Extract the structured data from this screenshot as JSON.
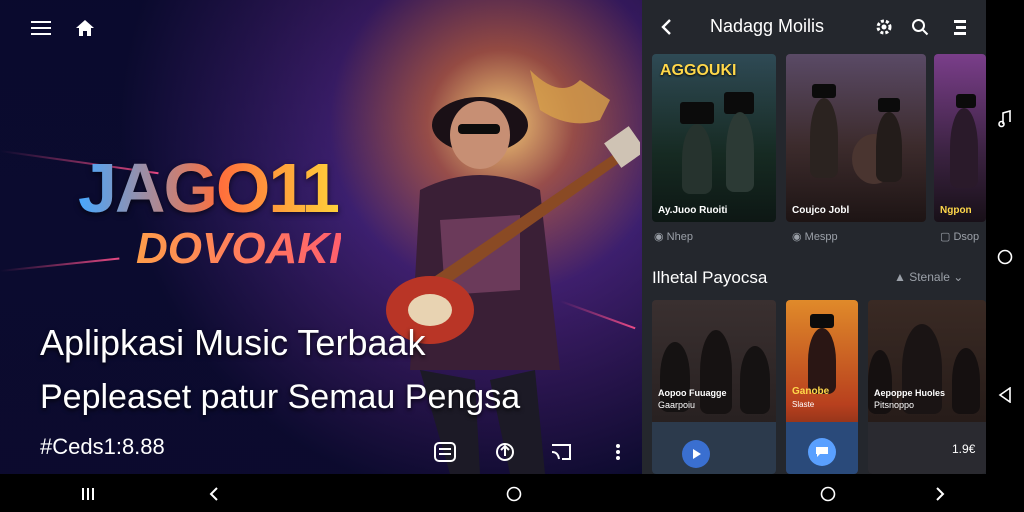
{
  "hero": {
    "logo_line1": "JAGO11",
    "logo_line2": "DOVOAKI",
    "title": "Aplipkasi Music Terbaak",
    "subtitle": "Pepleaset patur Semau Pengsa",
    "tag": "#Ceds1:8.88"
  },
  "panel": {
    "title": "Nadagg Moilis",
    "featured": [
      {
        "name": "AGGOUKI",
        "caption": "Ay.Juoo Ruoiti",
        "meta": "Nhep"
      },
      {
        "name": "",
        "caption": "Coujco Jobl",
        "meta": "Mespp"
      },
      {
        "name": "",
        "caption": "Ngpon",
        "meta": "Dsop"
      }
    ],
    "section_title": "Ilhetal Payocsa",
    "section_action": "Stenale",
    "tiles": [
      {
        "caption": "Aopoo Fuuagge",
        "sub": "Gaarpoiu"
      },
      {
        "caption": "Ganobe",
        "sub": "Slaste"
      },
      {
        "caption": "Aepoppe Huoles",
        "sub": "Pitsnoppo"
      }
    ],
    "bottom_value": "1.9€"
  },
  "icons": {
    "hero_menu": "menu-icon",
    "hero_home": "home-icon",
    "back": "back-arrow-icon",
    "settings": "gear-icon",
    "search": "search-icon",
    "more": "more-icon"
  }
}
